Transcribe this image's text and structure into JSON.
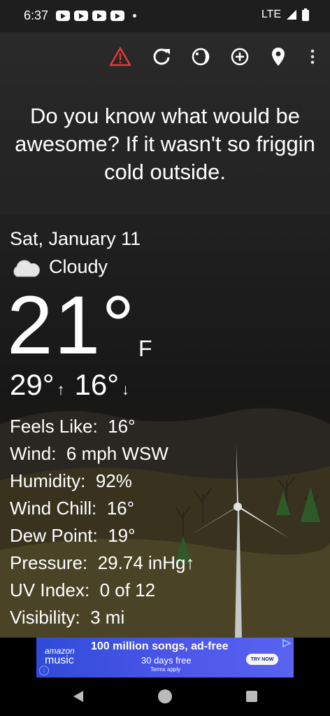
{
  "status_bar": {
    "time": "6:37",
    "network": "LTE"
  },
  "toolbar": {
    "icons": [
      "alert-icon",
      "refresh-icon",
      "theme-icon",
      "add-icon",
      "location-icon",
      "more-icon"
    ],
    "alert_color": "#e53935"
  },
  "headline": "Do you know what would be awesome? If it wasn't so friggin cold outside.",
  "weather": {
    "date": "Sat, January 11",
    "condition": "Cloudy",
    "temperature": "21°",
    "unit": "F",
    "high": "29°",
    "low": "16°",
    "high_arrow": "↑",
    "low_arrow": "↓"
  },
  "details": [
    {
      "label": "Feels Like:",
      "value": "16°"
    },
    {
      "label": "Wind:",
      "value": "6 mph WSW"
    },
    {
      "label": "Humidity:",
      "value": "92%"
    },
    {
      "label": "Wind Chill:",
      "value": "16°"
    },
    {
      "label": "Dew Point:",
      "value": "19°"
    },
    {
      "label": "Pressure:",
      "value": "29.74 inHg↑"
    },
    {
      "label": "UV Index:",
      "value": "0 of 12"
    },
    {
      "label": "Visibility:",
      "value": "3 mi"
    }
  ],
  "ad": {
    "brand_top": "amazon",
    "brand_bottom": "music",
    "headline": "100 million songs, ad-free",
    "sub": "30 days free",
    "terms": "Terms apply",
    "cta": "TRY NOW"
  }
}
